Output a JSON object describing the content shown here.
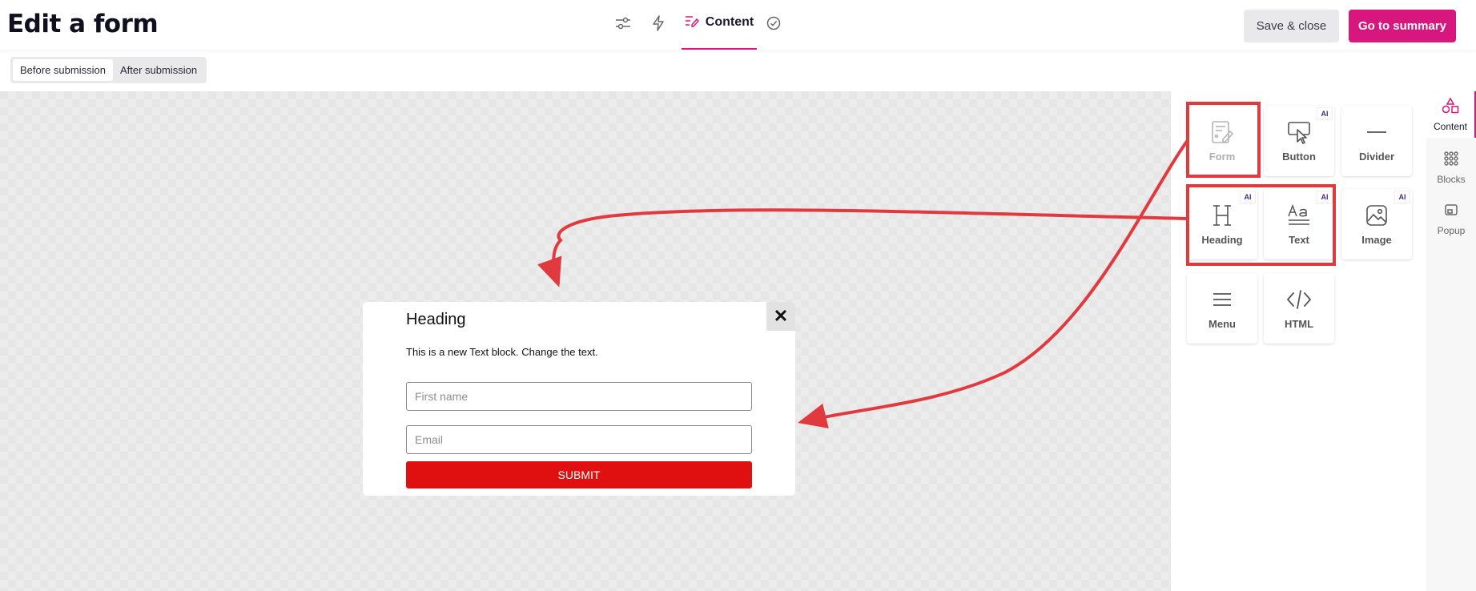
{
  "header": {
    "title": "Edit a form",
    "steps": [
      {
        "icon": "sliders-icon"
      },
      {
        "icon": "lightning-icon"
      },
      {
        "icon": "content-edit-icon",
        "label": "Content"
      },
      {
        "icon": "check-circle-icon"
      }
    ],
    "save_label": "Save & close",
    "summary_label": "Go to summary",
    "accent_color": "#d8177e"
  },
  "subbar": {
    "tabs": [
      "Before submission",
      "After submission"
    ],
    "active_tab": "Before submission"
  },
  "popup": {
    "heading": "Heading",
    "text": "This is a new Text block. Change the text.",
    "fields": [
      {
        "placeholder": "First name"
      },
      {
        "placeholder": "Email"
      }
    ],
    "submit_label": "SUBMIT",
    "submit_color": "#e01010",
    "close_glyph": "✕"
  },
  "panel": {
    "tiles": [
      {
        "label": "Form",
        "icon": "form-icon",
        "ai": false,
        "disabled": true
      },
      {
        "label": "Button",
        "icon": "button-pointer-icon",
        "ai": true,
        "ai_label": "AI"
      },
      {
        "label": "Divider",
        "icon": "divider-icon",
        "ai": false
      },
      {
        "label": "Heading",
        "icon": "heading-icon",
        "ai": true,
        "ai_label": "AI"
      },
      {
        "label": "Text",
        "icon": "text-icon",
        "ai": true,
        "ai_label": "AI"
      },
      {
        "label": "Image",
        "icon": "image-icon",
        "ai": true,
        "ai_label": "AI"
      },
      {
        "label": "Menu",
        "icon": "menu-icon",
        "ai": false
      },
      {
        "label": "HTML",
        "icon": "code-icon",
        "ai": false
      }
    ]
  },
  "rail": {
    "items": [
      {
        "label": "Content",
        "icon": "shapes-icon",
        "active": true
      },
      {
        "label": "Blocks",
        "icon": "grid-icon"
      },
      {
        "label": "Popup",
        "icon": "popup-icon"
      }
    ]
  },
  "annotation": {
    "color": "#e03a3e"
  }
}
